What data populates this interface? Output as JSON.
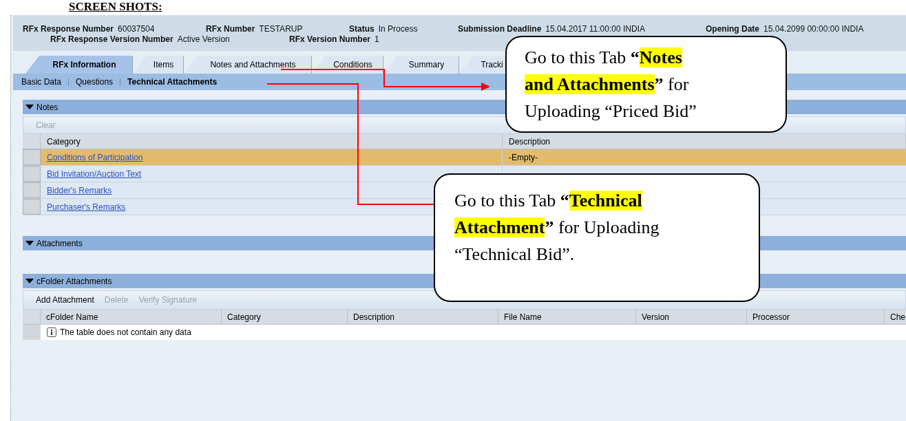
{
  "document": {
    "heading": "SCREEN SHOTS:"
  },
  "header": {
    "line_1": [
      {
        "label": "RFx Response Number",
        "value": "60037504"
      },
      {
        "label": "RFx Number",
        "value": "TESTARUP"
      },
      {
        "label": "Status",
        "value": "In Process"
      },
      {
        "label": "Submission Deadline",
        "value": "15.04.2017 11:00:00 INDIA"
      },
      {
        "label": "Opening Date",
        "value": "15.04.2099 00:00:00 INDIA"
      }
    ],
    "line_2": [
      {
        "label": "RFx Response Version Number",
        "value": "Active Version"
      },
      {
        "label": "RFx Version Number",
        "value": "1"
      }
    ]
  },
  "tabs": [
    {
      "label": "RFx Information",
      "selected": true
    },
    {
      "label": "Items",
      "selected": false
    },
    {
      "label": "Notes and Attachments",
      "selected": false
    },
    {
      "label": "Conditions",
      "selected": false
    },
    {
      "label": "Summary",
      "selected": false
    },
    {
      "label": "Tracki",
      "selected": false
    }
  ],
  "subtabs": [
    {
      "label": "Basic Data",
      "selected": false
    },
    {
      "label": "Questions",
      "selected": false
    },
    {
      "label": "Technical Attachments",
      "selected": true
    }
  ],
  "notes": {
    "title": "Notes",
    "expanded": true,
    "toolbar": [
      {
        "label": "Clear",
        "disabled": true
      }
    ],
    "columns": [
      "Category",
      "Description"
    ],
    "rows": [
      {
        "category": "Conditions of Participation",
        "description": "-Empty-",
        "selected": true
      },
      {
        "category": "Bid Invitation/Auction Text",
        "selected": false
      },
      {
        "category": "Bidder's Remarks",
        "selected": false
      },
      {
        "category": "Purchaser's Remarks",
        "selected": false
      }
    ]
  },
  "attachments": {
    "title": "Attachments",
    "expanded": true
  },
  "cfolder": {
    "title": "cFolder Attachments",
    "expanded": true,
    "toolbar": [
      {
        "label": "Add Attachment",
        "disabled": false
      },
      {
        "label": "Delete",
        "disabled": true
      },
      {
        "label": "Verify Signature",
        "disabled": true
      }
    ],
    "columns": [
      "cFolder Name",
      "Category",
      "Description",
      "File Name",
      "Version",
      "Processor",
      "Che"
    ],
    "empty_message": "The table does not contain any data"
  },
  "callouts": [
    {
      "parts": [
        {
          "text": "Go to this Tab ",
          "bold": false,
          "highlight": false
        },
        {
          "text": "“",
          "bold": true,
          "highlight": false
        },
        {
          "text": "Notes and Attachments",
          "bold": true,
          "highlight": true
        },
        {
          "text": "”",
          "bold": true,
          "highlight": false
        },
        {
          "text": " for Uploading “Priced Bid”",
          "bold": false,
          "highlight": false
        }
      ]
    },
    {
      "parts": [
        {
          "text": "Go to this Tab ",
          "bold": false,
          "highlight": false
        },
        {
          "text": "“",
          "bold": true,
          "highlight": false
        },
        {
          "text": "Technical Attachment",
          "bold": true,
          "highlight": true
        },
        {
          "text": "”",
          "bold": true,
          "highlight": false
        },
        {
          "text": " for Uploading “Technical Bid”.",
          "bold": false,
          "highlight": false
        }
      ]
    }
  ]
}
